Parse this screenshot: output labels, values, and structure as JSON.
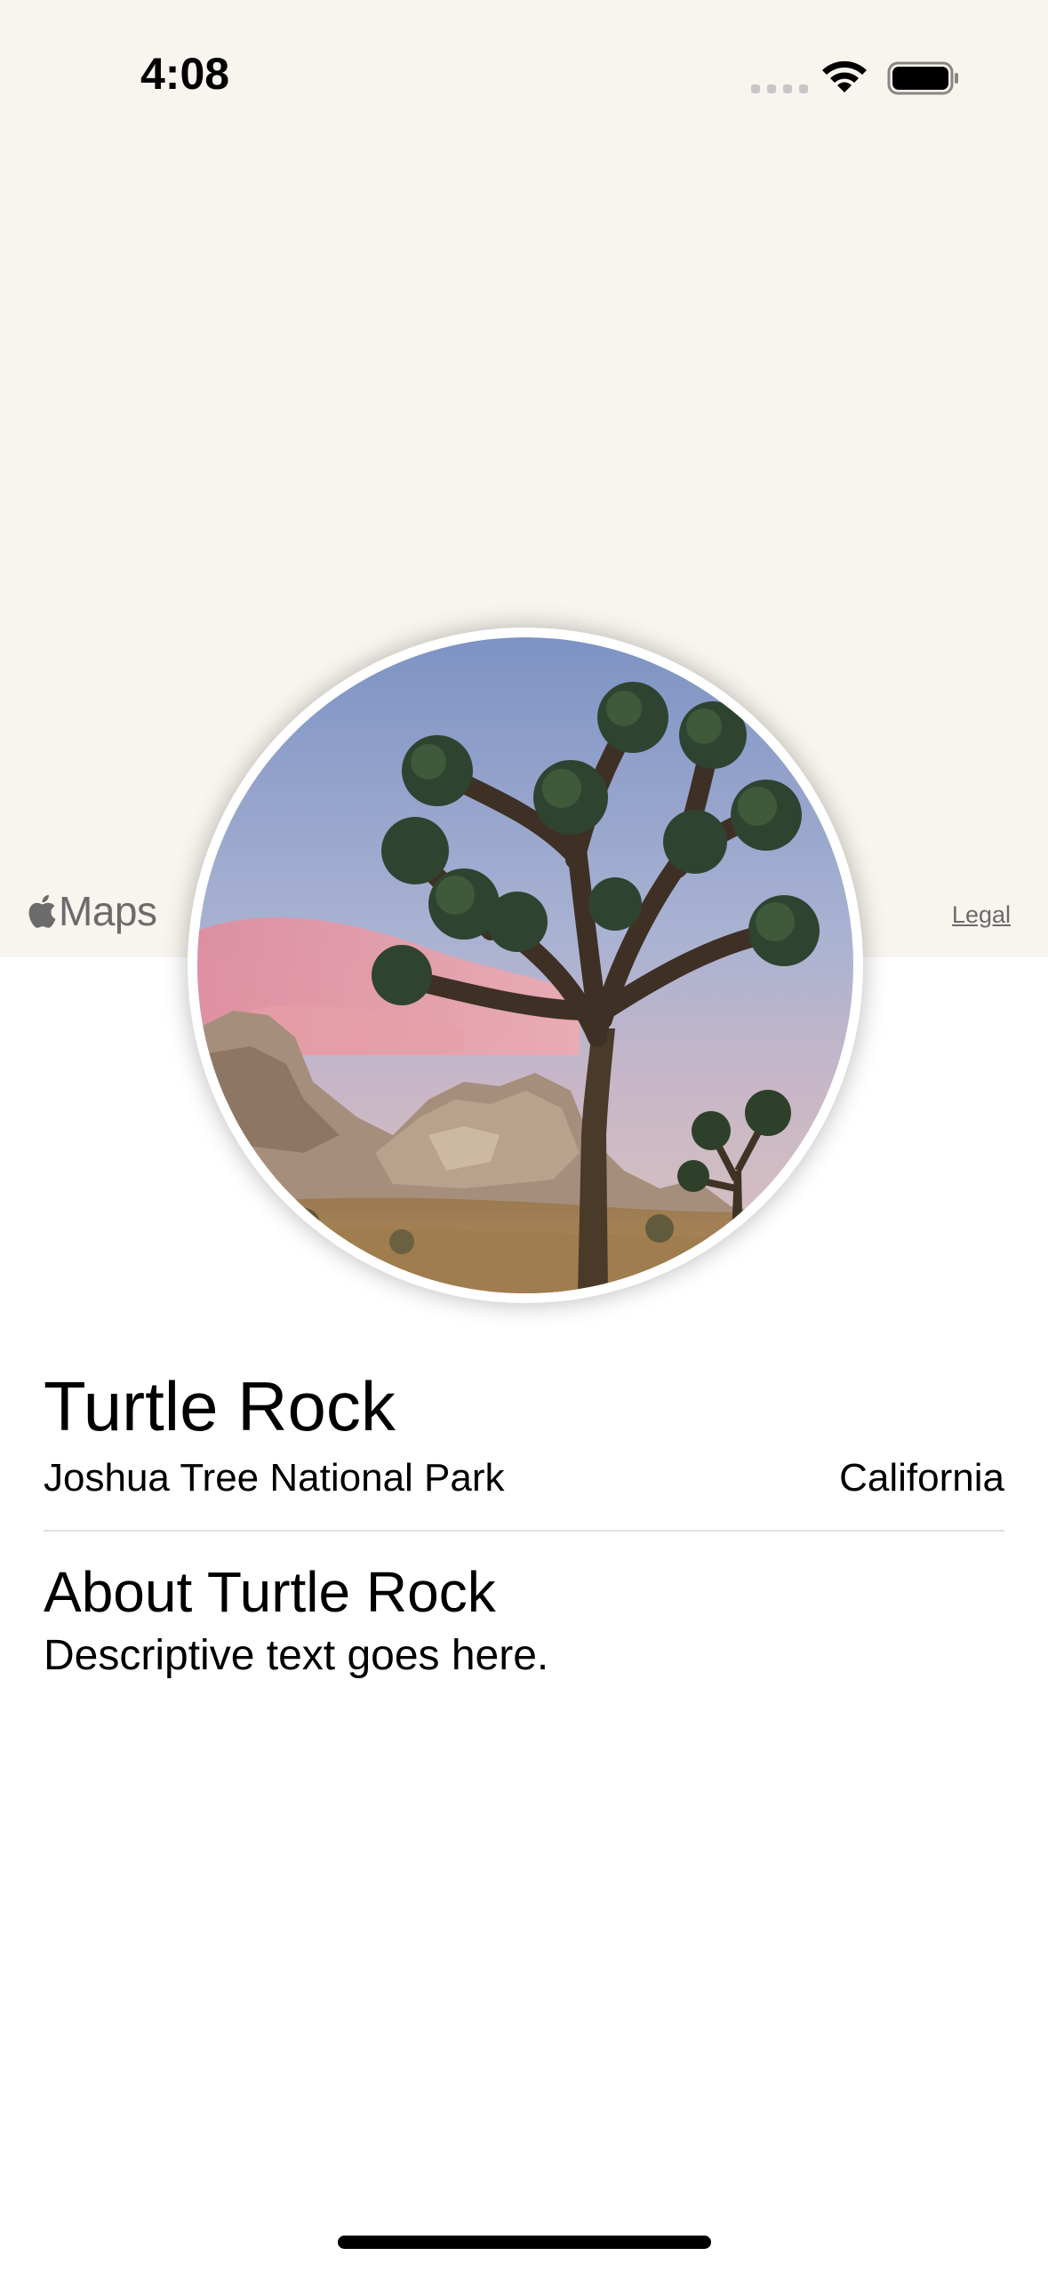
{
  "status_bar": {
    "time": "4:08"
  },
  "map": {
    "attribution_label": "Maps",
    "legal_link": "Legal",
    "background_color": "#f8f4ee"
  },
  "landmark": {
    "name": "Turtle Rock",
    "park": "Joshua Tree National Park",
    "state": "California",
    "about_heading": "About Turtle Rock",
    "description": "Descriptive text goes here."
  },
  "icons": {
    "apple_logo": "apple-icon",
    "wifi": "wifi-icon",
    "battery": "battery-icon",
    "cellular": "cellular-signal-icon"
  }
}
